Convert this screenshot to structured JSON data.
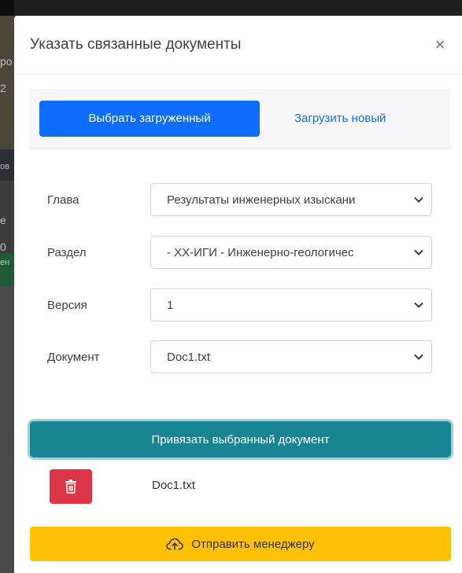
{
  "backdrop": {
    "fragments": [
      "ро",
      "2",
      "ов",
      "е",
      "0",
      "ен"
    ]
  },
  "modal": {
    "title": "Указать связанные документы",
    "close_symbol": "×"
  },
  "tabs": {
    "active_label": "Выбрать загруженный",
    "link_label": "Загрузить новый"
  },
  "form": {
    "chapter": {
      "label": "Глава",
      "value": "Результаты инженерных изыскани"
    },
    "section": {
      "label": "Раздел",
      "value": "- ХХ-ИГИ - Инженерно-геологичес"
    },
    "version": {
      "label": "Версия",
      "value": "1"
    },
    "document": {
      "label": "Документ",
      "value": "Doc1.txt"
    }
  },
  "bind_button": {
    "label": "Привязать выбранный документ"
  },
  "attached_document": {
    "name": "Doc1.txt",
    "delete_icon": "trash-icon"
  },
  "send_button": {
    "label": "Отправить менеджеру",
    "icon": "cloud-upload-icon"
  },
  "colors": {
    "primary": "#0d6efd",
    "teal": "#178690",
    "danger": "#dc3545",
    "warning": "#ffc107"
  }
}
